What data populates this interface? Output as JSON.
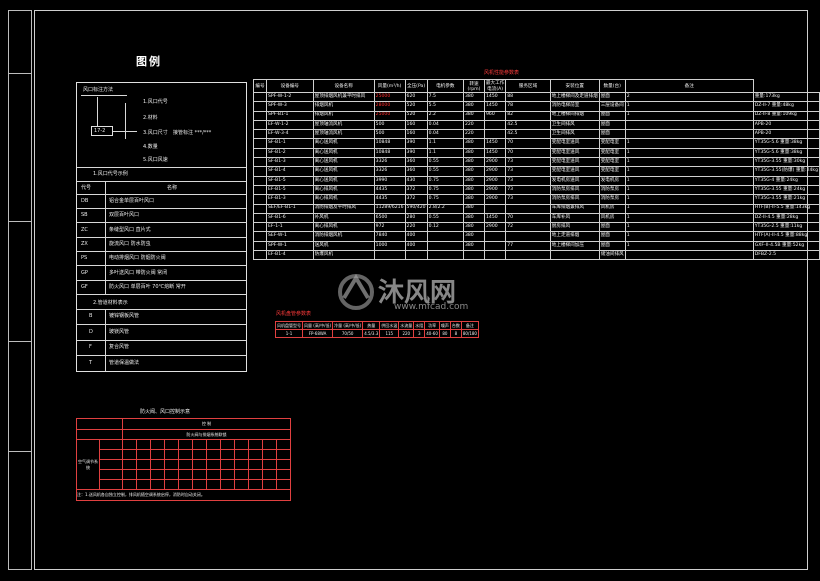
{
  "legend_title": "图例",
  "left_box": {
    "section_a_title": "风口标注方法",
    "items": [
      "1.风口代号",
      "2.材料",
      "3.风口尺寸",
      "4.数量",
      "5.风口风速"
    ],
    "item3_suffix": "接管标注 ***/***",
    "box_code": "17-2",
    "section_b_title": "1.风口代号示例",
    "header": [
      "代号",
      "名称"
    ],
    "codes": [
      {
        "code": "DB",
        "name": "铝合金单层百叶风口"
      },
      {
        "code": "SB",
        "name": "双层百叶风口"
      },
      {
        "code": "ZC",
        "name": "条缝型风口 直片式"
      },
      {
        "code": "ZX",
        "name": "旋流风口 防水防虫"
      },
      {
        "code": "PS",
        "name": "电动排烟风口 防烟防火阀"
      },
      {
        "code": "GP",
        "name": "多叶送风口 带防火阀 常闭"
      },
      {
        "code": "GF",
        "name": "防火风口 单层百叶 70℃熔断 常开"
      }
    ],
    "section_c_title": "2.管道材料表示",
    "materials": [
      {
        "code": "B",
        "name": "镀锌钢板风管"
      },
      {
        "code": "D",
        "name": "玻镁风管"
      },
      {
        "code": "F",
        "name": "复合风管"
      },
      {
        "code": "T",
        "name": "管道保温做法"
      }
    ]
  },
  "main_title": "风机性能参数表",
  "main_table": {
    "headers": [
      "编号",
      "设备编号",
      "设备名称",
      "风量(m³/h)",
      "全压(Pa)",
      "电机参数",
      "转速(rpm)",
      "最大工作电流(A)",
      "服务区域",
      "安装位置",
      "数量(台)",
      "备注"
    ],
    "rows": [
      [
        "SPF-W-1-2",
        "屋顶排烟风机兼平时排风",
        "25000",
        "620",
        "7.5",
        "380",
        "1450",
        "88",
        "地上楼梯间及走道排烟",
        "屋面",
        "2",
        "重量:173kg"
      ],
      [
        "SPF-W-3",
        "排烟风机",
        "28000",
        "520",
        "5.5",
        "380",
        "1450",
        "78",
        "消防电梯前室",
        "三层设备间",
        "1",
        "DZ-II-7 重量:48kg"
      ],
      [
        "SPF-B1-1",
        "排烟风机",
        "25000",
        "520",
        "2.2",
        "380",
        "960",
        "82",
        "地上楼梯间排烟",
        "屋面",
        "1",
        "DZ-II-8 重量:109kg"
      ],
      [
        "EF-W-1-2",
        "屋顶轴流风机",
        "500",
        "160",
        "0.04",
        "220",
        "",
        "42.5",
        "卫生间排风",
        "屋面",
        "",
        "APB-20"
      ],
      [
        "EF-W-3-4",
        "屋顶轴流风机",
        "500",
        "160",
        "0.04",
        "220",
        "",
        "42.5",
        "卫生间排风",
        "屋面",
        "",
        "APB-20"
      ],
      [
        "SF-B1-1",
        "离心送风机",
        "10848",
        "390",
        "1.1",
        "380",
        "1450",
        "70",
        "变配电室送风",
        "变配电室",
        "1",
        "YT35G-5.6 重量:38kg"
      ],
      [
        "SF-B1-2",
        "离心送风机",
        "10848",
        "390",
        "1.1",
        "380",
        "1450",
        "70",
        "变配电室送风",
        "变配电室",
        "1",
        "YT35G-5.6 重量:38kg"
      ],
      [
        "SF-B1-3",
        "离心送风机",
        "3326",
        "360",
        "0.55",
        "380",
        "2900",
        "73",
        "变配电室送风",
        "变配电室",
        "1",
        "YT35G-3.55 重量:30kg"
      ],
      [
        "SF-B1-4",
        "离心送风机",
        "3326",
        "360",
        "0.55",
        "380",
        "2900",
        "73",
        "变配电室送风",
        "变配电室",
        "1",
        "YT35G-3.55(防爆) 重量:24kg"
      ],
      [
        "SF-B1-5",
        "离心送风机",
        "3990",
        "430",
        "0.75",
        "380",
        "2900",
        "73",
        "发电机房送风",
        "发电机房",
        "1",
        "YT35G-4 重量:24kg"
      ],
      [
        "EF-B1-5",
        "离心排风机",
        "4435",
        "372",
        "0.75",
        "380",
        "2900",
        "73",
        "消防泵房排风",
        "消防泵房",
        "1",
        "YT35G-3.55 重量:24kg"
      ],
      [
        "EF-B1-3",
        "离心排风机",
        "4435",
        "372",
        "0.75",
        "380",
        "2900",
        "73",
        "消防泵房排风",
        "消防泵房",
        "1",
        "YT35G-3.55 重量:21kg"
      ],
      [
        "SEF/EF-B1-1",
        "消防排烟及平时排风",
        "11289/6216",
        "590/420",
        "2.8/2.2",
        "380",
        "",
        "",
        "车库排烟兼排风",
        "风机房",
        "1",
        "HTF(B)-II-5.5 重量:143kg"
      ],
      [
        "SF-B1-6",
        "补风机",
        "6500",
        "280",
        "0.55",
        "380",
        "1450",
        "70",
        "车库补风",
        "风机房",
        "1",
        "DZ-II-4.5 重量:28kg"
      ],
      [
        "EF-1-1",
        "离心排风机",
        "972",
        "220",
        "0.12",
        "380",
        "2900",
        "72",
        "厨房排风",
        "屋面",
        "1",
        "YT35G-2.5 重量:11kg"
      ],
      [
        "SEF-W-1",
        "消防排烟风机",
        "7840",
        "400",
        "",
        "380",
        "",
        "",
        "地上走道排烟",
        "屋面",
        "1",
        "HTF(A)-II-4.5 重量:88kg"
      ],
      [
        "SPF-W-1",
        "送风机",
        "1000",
        "400",
        "",
        "380",
        "",
        "77",
        "地上楼梯间加压",
        "屋面",
        "1",
        "GXF-II-4.5B 重量:52kg"
      ],
      [
        "EF-B1-4",
        "防爆风机",
        "",
        "",
        "",
        "",
        "",
        "",
        "",
        "储油间排风",
        "",
        "DFBZ-2.5"
      ]
    ]
  },
  "fan_title": "风机盘管参数表",
  "fan_table": {
    "headers": [
      "风机盘管型号",
      "风量 (高/中/低)",
      "冷量 (高/中/低)",
      "热量",
      "供回水温",
      "水流量",
      "水阻",
      "功率",
      "噪声",
      "台数",
      "备注"
    ],
    "row": [
      "1-1",
      "FP-68WA",
      "70/50",
      "4.5/3.3",
      "115",
      "220",
      "3",
      "40-60",
      "80",
      "8",
      "80/180",
      "5%"
    ]
  },
  "matrix_title": "防火阀、风口控制示意",
  "matrix_header": "控 制",
  "matrix_sub": "防火阀与排烟系统联锁",
  "matrix_row_label": "空气调节系统",
  "matrix_note": "注：1.送风机各自独立控制，排风机随空调系统启停，消防时自动关闭。",
  "watermark": "沐风网",
  "watermark_url": "www.mfcad.com"
}
